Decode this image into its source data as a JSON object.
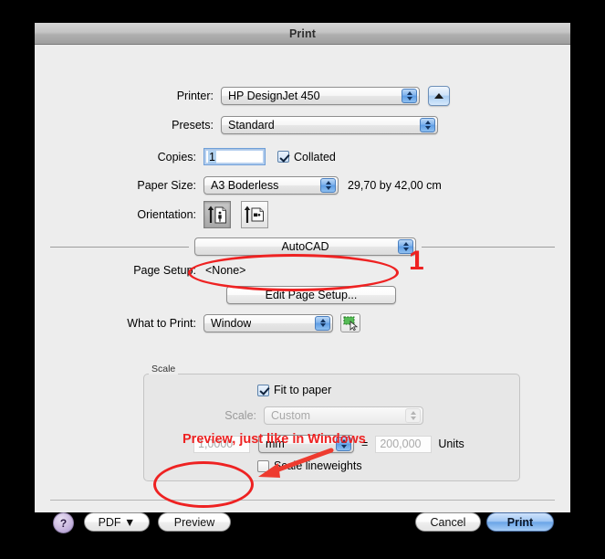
{
  "window": {
    "title": "Print"
  },
  "printer_row": {
    "label": "Printer:",
    "value": "HP DesignJet 450",
    "disclosure_icon": "triangle-up-icon"
  },
  "presets_row": {
    "label": "Presets:",
    "value": "Standard"
  },
  "copies_row": {
    "label": "Copies:",
    "value": "1",
    "collated_label": "Collated",
    "collated_checked": true
  },
  "paper_size_row": {
    "label": "Paper Size:",
    "value": "A3 Boderless",
    "dimensions": "29,70 by 42,00 cm"
  },
  "orientation_row": {
    "label": "Orientation:",
    "portrait_icon": "page-portrait-icon",
    "landscape_icon": "page-landscape-icon",
    "selected": "portrait"
  },
  "pane_popup": {
    "value": "AutoCAD"
  },
  "page_setup_row": {
    "label": "Page Setup:",
    "value": "<None>"
  },
  "edit_page_setup_button": {
    "label": "Edit Page Setup..."
  },
  "what_to_print_row": {
    "label": "What to Print:",
    "value": "Window",
    "pick_icon": "selection-marquee-icon"
  },
  "scale_group": {
    "caption": "Scale",
    "fit_to_paper": {
      "label": "Fit to paper",
      "checked": true
    },
    "scale_label": "Scale:",
    "scale_value": "Custom",
    "ratio_left": "1,0000",
    "unit_value": "mm",
    "equals": "=",
    "ratio_right": "200,000",
    "units_label": "Units",
    "lineweights": {
      "label": "Scale lineweights",
      "checked": false
    }
  },
  "footer": {
    "help_label": "?",
    "pdf_label": "PDF ▼",
    "preview_label": "Preview",
    "cancel_label": "Cancel",
    "print_label": "Print"
  },
  "annotations": {
    "number_one": "1",
    "preview_note": "Preview, just like in Windows",
    "color": "#ee2222"
  }
}
